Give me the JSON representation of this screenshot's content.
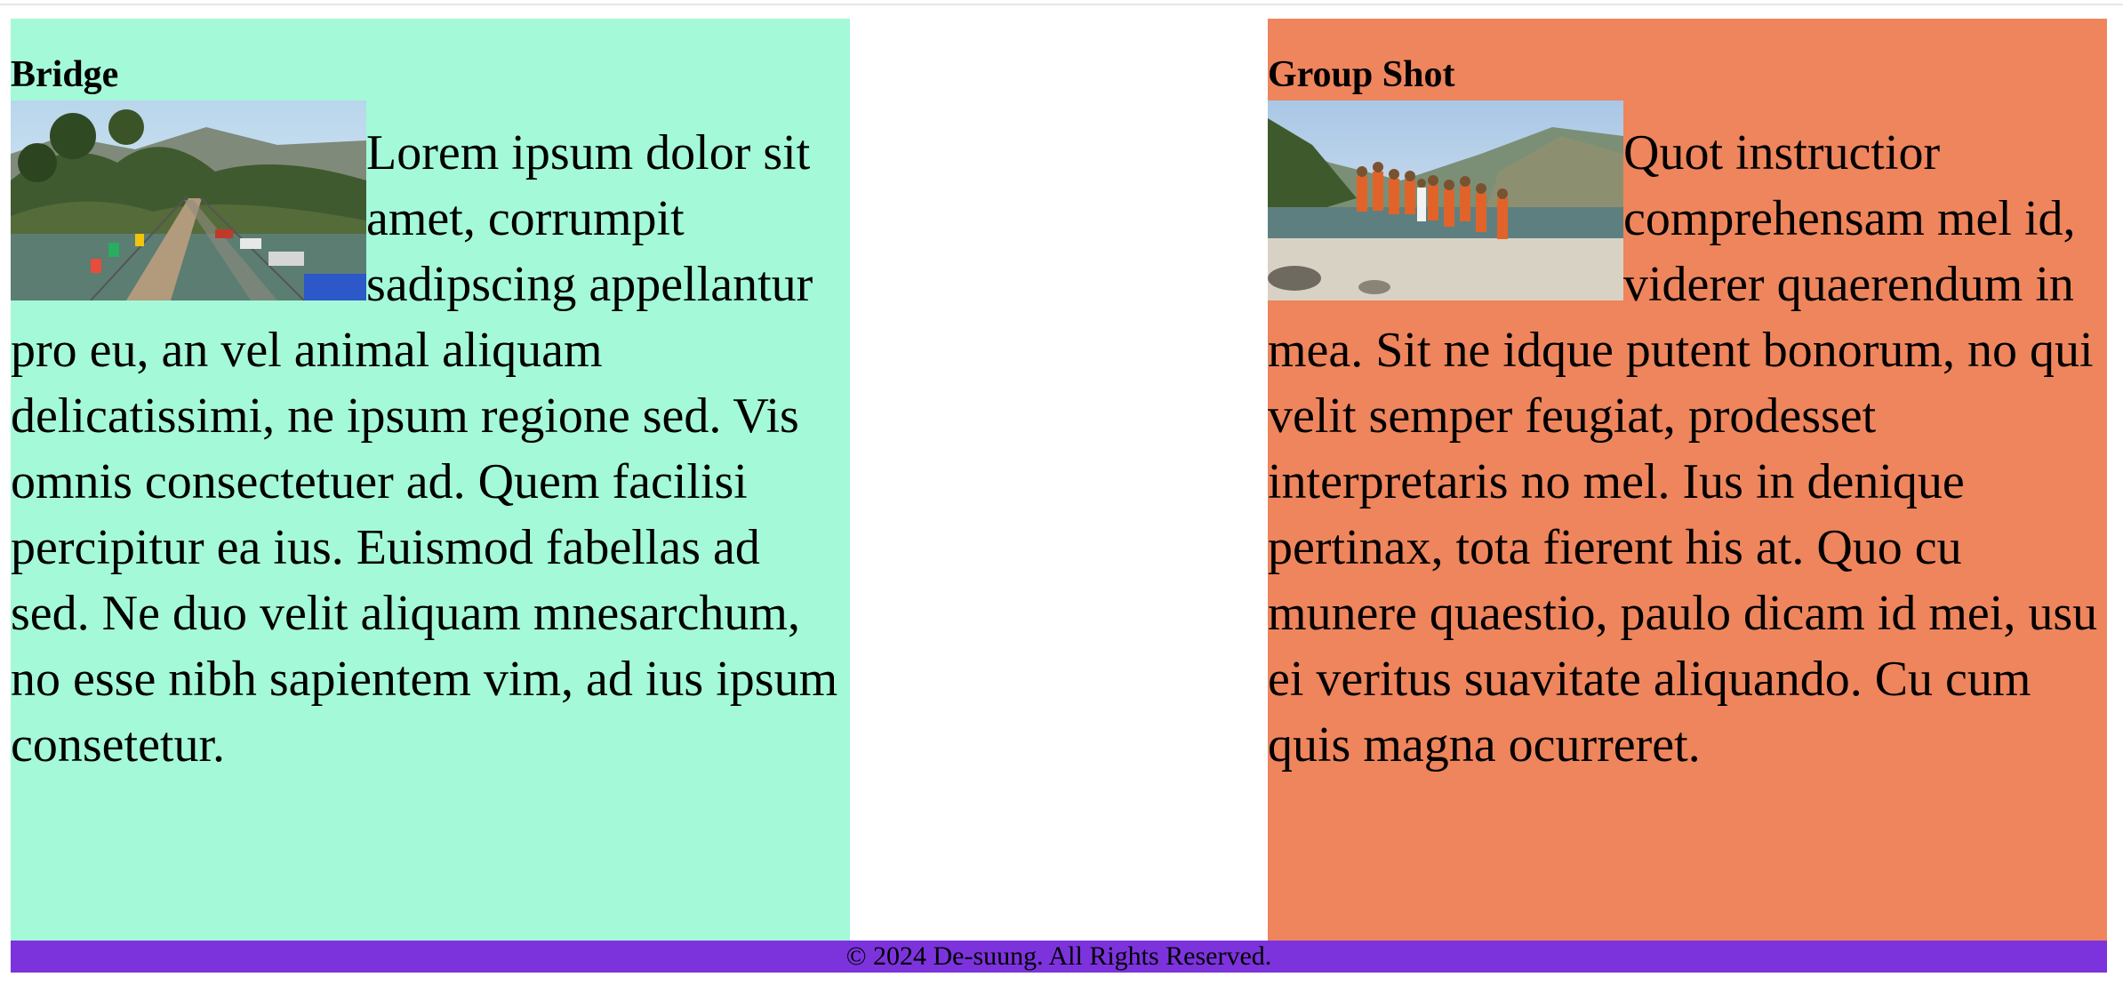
{
  "cards": [
    {
      "title": "Bridge",
      "image_alt": "suspension bridge with prayer flags",
      "text": "Lorem ipsum dolor sit amet, corrumpit sadipscing appellantur pro eu, an vel animal aliquam delicatissimi, ne ipsum regione sed. Vis omnis consectetuer ad. Quem facilisi percipitur ea ius. Euismod fabellas ad sed. Ne duo velit aliquam mnesarchum, no esse nibh sapientem vim, ad ius ipsum consetetur.",
      "background": "#a4f9d8"
    },
    {
      "title": "Group Shot",
      "image_alt": "group of people in orange uniforms by a river",
      "text": "Quot instructior comprehensam mel id, viderer quaerendum in mea. Sit ne idque putent bonorum, no qui velit semper feugiat, prodesset interpretaris no mel. Ius in denique pertinax, tota fierent his at. Quo cu munere quaestio, paulo dicam id mei, usu ei veritus suavitate aliquando. Cu cum quis magna ocurreret.",
      "background": "#ee855c"
    }
  ],
  "footer": {
    "text": "© 2024 De-suung. All Rights Reserved.",
    "background": "#7c33dc"
  }
}
